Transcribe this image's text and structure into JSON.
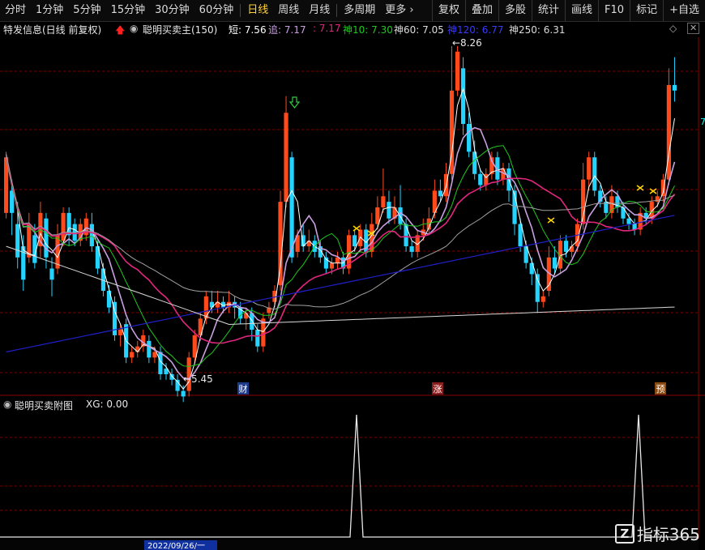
{
  "toolbar": {
    "periods": [
      "分时",
      "1分钟",
      "5分钟",
      "15分钟",
      "30分钟",
      "60分钟",
      "日线",
      "周线",
      "月线",
      "多周期",
      "更多"
    ],
    "active_index": 6,
    "right_items": [
      "复权",
      "叠加",
      "多股",
      "统计",
      "画线",
      "F10",
      "标记",
      "+自选"
    ]
  },
  "info": {
    "stock": "特发信息(日线 前复权)",
    "indicator": "聪明买卖主(150)",
    "short_label": "短: 7.56",
    "chase_label": "追: 7.17",
    "hidden_label": ": 7.17",
    "god10": "神10: 7.30",
    "god60": "神60: 7.05",
    "god120": "神120: 6.77",
    "god250": "神250: 6.31",
    "colors": {
      "short": "#ffffff",
      "chase": "#c0a0d0",
      "god10": "#00dd00",
      "god60": "#dddddd",
      "god120": "#3a3aff",
      "god250": "#dddddd"
    }
  },
  "price_labels": {
    "high": "8.26",
    "low": "5.45",
    "axis_right": "7"
  },
  "markers": [
    "财",
    "涨",
    "预"
  ],
  "sub": {
    "title": "聪明买卖附图",
    "xg": "XG: 0.00"
  },
  "date_label": "2022/09/26/一",
  "watermark": "指标365",
  "watermark_logo": "Z",
  "colors": {
    "up": "#ff4a1c",
    "down": "#22d4ff",
    "grid": "#7a0000",
    "ma_pink": "#e0267d",
    "ma_green": "#1ec81e",
    "ma_lilac": "#c8a0e0",
    "ma_blue": "#2020c8",
    "ma_gray": "#a0a0a0"
  }
}
